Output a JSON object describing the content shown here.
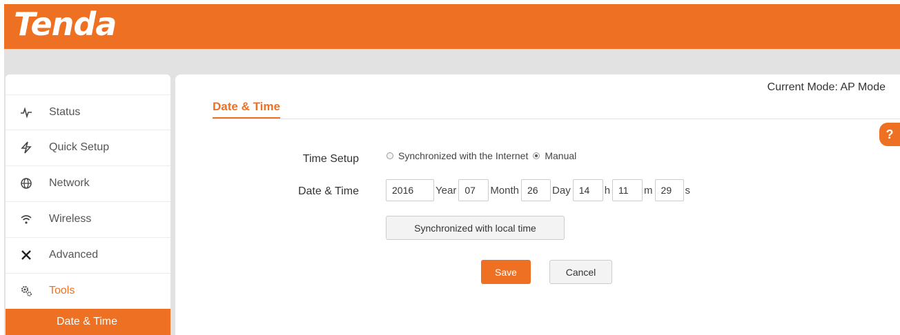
{
  "brand": {
    "logo_text": "Tenda",
    "accent": "#ee7022"
  },
  "header": {
    "current_mode": "Current Mode: AP Mode"
  },
  "sidebar": {
    "items": [
      {
        "label": "Status",
        "icon": "pulse-icon"
      },
      {
        "label": "Quick Setup",
        "icon": "lightning-icon"
      },
      {
        "label": "Network",
        "icon": "globe-icon"
      },
      {
        "label": "Wireless",
        "icon": "wifi-icon"
      },
      {
        "label": "Advanced",
        "icon": "tools-icon"
      },
      {
        "label": "Tools",
        "icon": "gears-icon",
        "active": true
      }
    ],
    "sub_item": "Date & Time"
  },
  "main": {
    "title": "Date & Time",
    "help": "?",
    "time_setup": {
      "label": "Time Setup",
      "options": [
        "Synchronized with the Internet",
        "Manual"
      ],
      "selected": "Manual"
    },
    "date_time": {
      "label": "Date & Time",
      "year": "2016",
      "year_unit": "Year",
      "month": "07",
      "month_unit": "Month",
      "day": "26",
      "day_unit": "Day",
      "hour": "14",
      "hour_unit": "h",
      "minute": "11",
      "minute_unit": "m",
      "second": "29",
      "second_unit": "s"
    },
    "sync_local_button": "Synchronized with local time",
    "save_button": "Save",
    "cancel_button": "Cancel"
  }
}
